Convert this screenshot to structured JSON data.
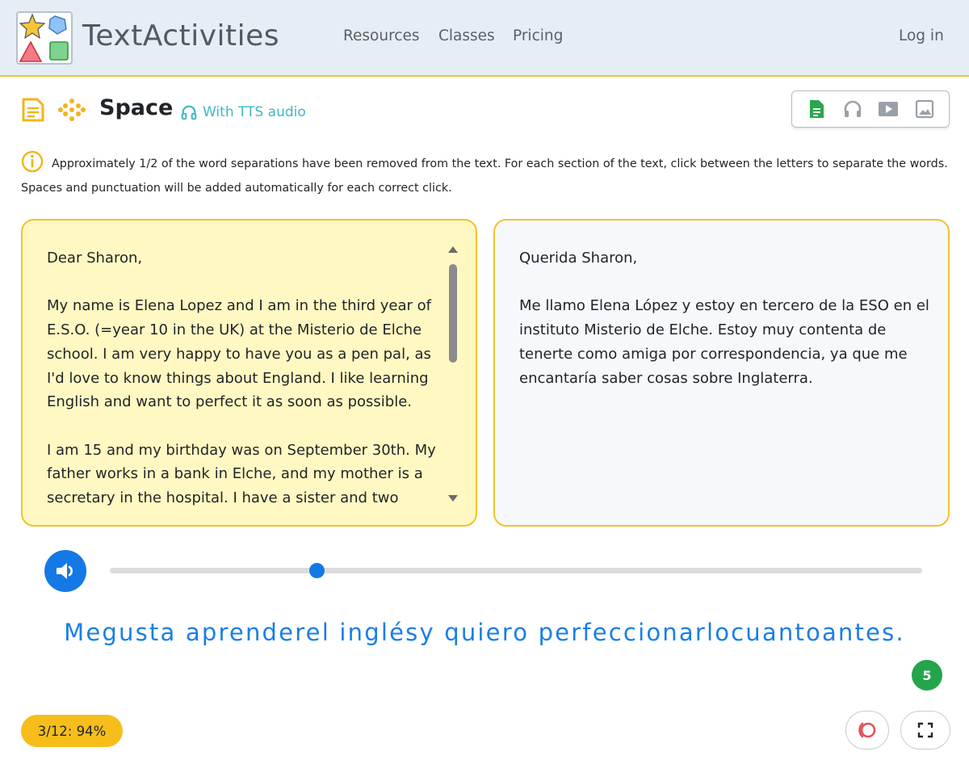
{
  "navbar": {
    "brand": "TextActivities",
    "links": {
      "resources": "Resources",
      "classes": "Classes",
      "pricing": "Pricing"
    },
    "login": "Log in"
  },
  "activity": {
    "title": "Space",
    "tts_label": "With TTS audio",
    "icons": [
      "document-icon",
      "dots-icon",
      "headphones-icon"
    ],
    "media_buttons": [
      "text-icon",
      "headphones-icon",
      "video-icon",
      "image-icon"
    ]
  },
  "instructions": "Approximately 1/2 of the word separations have been removed from the text. For each section of the text, click between the letters to separate the words. Spaces and punctuation will be added automatically for each correct click.",
  "left_panel": {
    "paragraphs": [
      "Dear Sharon,",
      "My name is Elena Lopez and I am in the third year of E.S.O. (=year 10 in the UK) at the Misterio de Elche school. I am very happy to have you as a pen pal, as I'd love to know things about England. I like learning English and want to perfect it as soon as possible.",
      "I am 15 and my birthday was on September 30th. My father works in a bank in Elche, and my mother is a secretary in the hospital. I have a sister and two"
    ]
  },
  "right_panel": {
    "paragraphs": [
      "Querida Sharon,",
      "Me llamo Elena López y estoy en tercero de la ESO en el instituto Misterio de Elche. Estoy muy contenta de tenerte como amiga por correspondencia, ya que me encantaría saber cosas sobre Inglaterra."
    ]
  },
  "audio": {
    "progress": 0.255
  },
  "sentence": "Megusta aprenderel inglésy quiero perfeccionarlocuantoantes.",
  "remaining_count": "5",
  "score": "3/12: 94%",
  "colors": {
    "accent_blue": "#1479e6",
    "accent_yellow": "#f3c22b",
    "score_yellow": "#f7bd1b",
    "success_green": "#24a54a",
    "tts_teal": "#3fb7c4"
  }
}
